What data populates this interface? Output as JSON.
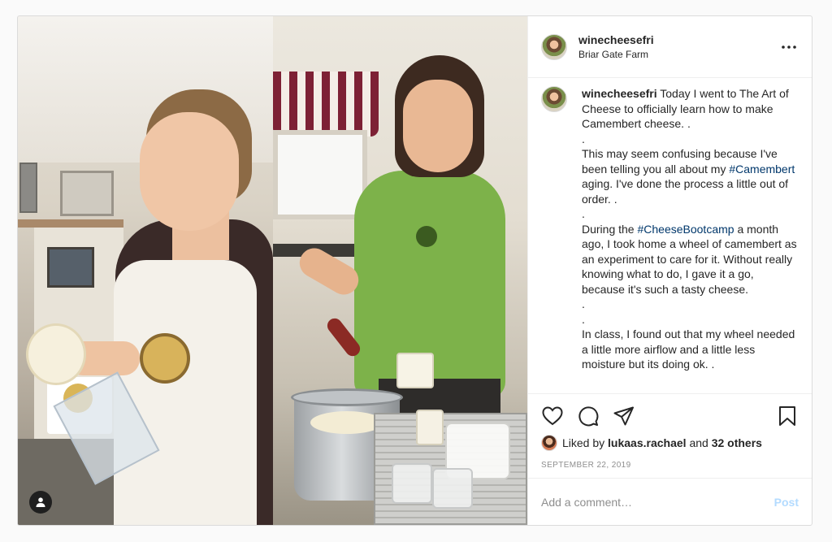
{
  "post": {
    "username": "winecheesefri",
    "location": "Briar Gate Farm"
  },
  "caption": {
    "username": "winecheesefri",
    "line1": "Today I went to The Art of Cheese to officially learn how to make Camembert cheese. .",
    "dot1": ".",
    "line2_a": "This may seem confusing because I've been telling you all about my ",
    "hashtag_camembert": "#Camembert",
    "line2_b": " aging. I've done the process a little out of order. .",
    "dot2": ".",
    "line3_a": "During the ",
    "hashtag_bootcamp": "#CheeseBootcamp",
    "line3_b": " a month ago, I took home a wheel of camembert as an experiment to care for it. Without really knowing what to do, I gave it a go, because it's such a tasty cheese.",
    "dot3": ".",
    "dot4": ".",
    "line4": "In class, I found out that my wheel needed a little more airflow and a little less moisture but its doing ok. ."
  },
  "likes": {
    "prefix": "Liked by",
    "liker": "lukaas.rachael",
    "and": "and",
    "others": "32 others"
  },
  "date": "September 22, 2019",
  "comment": {
    "placeholder": "Add a comment…",
    "post_label": "Post"
  },
  "colors": {
    "link": "#00376b",
    "muted": "#8e8e8e",
    "post_button": "#b3dbff"
  },
  "icons": [
    "heart-icon",
    "comment-icon",
    "share-icon",
    "bookmark-icon",
    "more-icon",
    "user-tag-icon"
  ]
}
